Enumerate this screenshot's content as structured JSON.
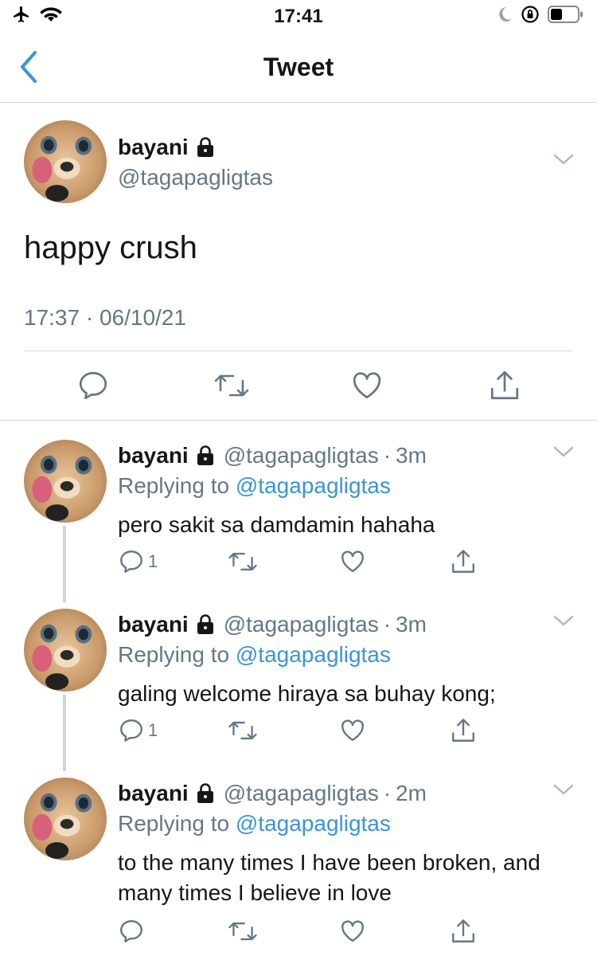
{
  "status_bar": {
    "time": "17:41"
  },
  "nav": {
    "title": "Tweet"
  },
  "main_tweet": {
    "name": "bayani",
    "handle": "@tagapagligtas",
    "text": "happy crush",
    "timestamp": "17:37 · 06/10/21"
  },
  "replies": [
    {
      "name": "bayani",
      "handle": "@tagapagligtas",
      "dot": "·",
      "time": "3m",
      "replying_prefix": "Replying to",
      "replying_to": "@tagapagligtas",
      "text": "pero sakit sa damdamin hahaha",
      "reply_count": "1"
    },
    {
      "name": "bayani",
      "handle": "@tagapagligtas",
      "dot": "·",
      "time": "3m",
      "replying_prefix": "Replying to",
      "replying_to": "@tagapagligtas",
      "text": "galing welcome hiraya sa buhay kong;",
      "reply_count": "1"
    },
    {
      "name": "bayani",
      "handle": "@tagapagligtas",
      "dot": "·",
      "time": "2m",
      "replying_prefix": "Replying to",
      "replying_to": "@tagapagligtas",
      "text": "to the many times I have been broken, and many times I believe in love",
      "reply_count": ""
    }
  ],
  "colors": {
    "accent": "#3b94d9",
    "secondary_text": "#657786",
    "primary_text": "#14171a",
    "divider": "#d6d9db"
  },
  "icons": [
    "airplane-icon",
    "wifi-icon",
    "moon-icon",
    "orientation-lock-icon",
    "battery-icon",
    "back-icon",
    "lock-icon",
    "chevron-down-icon",
    "reply-icon",
    "retweet-icon",
    "like-icon",
    "share-icon"
  ]
}
